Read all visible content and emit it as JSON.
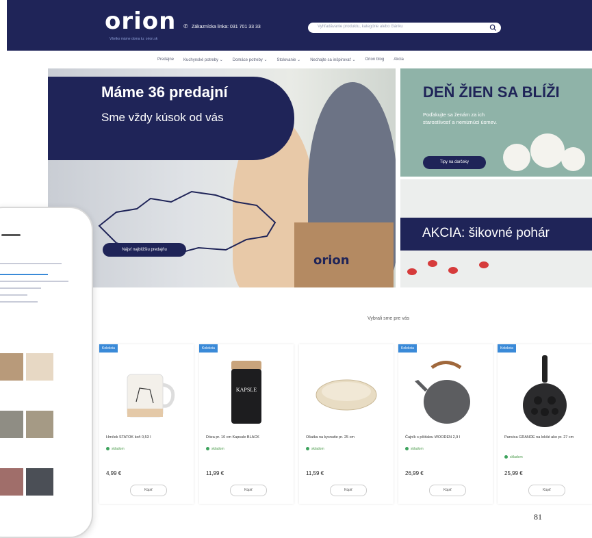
{
  "header": {
    "logo": "orion",
    "tagline": "Všetko máme doma tu: orion.sk",
    "phone": "Zákaznícka linka: 031 701 33 33",
    "search_placeholder": "Vyhľadávanie produktu, kategórie alebo článku",
    "bg_color": "#1f2458",
    "accent_color": "#3fa9f5"
  },
  "nav": {
    "items": [
      {
        "label": "Predajne"
      },
      {
        "label": "Kuchynské potreby ⌄"
      },
      {
        "label": "Domáce potreby ⌄"
      },
      {
        "label": "Stolovanie ⌄"
      },
      {
        "label": "Nechajte sa inšpirovať ⌄"
      },
      {
        "label": "Orion blog"
      },
      {
        "label": "Akcia"
      }
    ]
  },
  "hero": {
    "title": "Máme 36 predajní",
    "subtitle": "Sme vždy kúsok od vás",
    "button": "Nájsť najbližšiu predajňu",
    "bag_logo": "orion"
  },
  "promo1": {
    "title": "DEŇ ŽIEN SA BLÍŽI",
    "text": "Poďakujte sa ženám za ich starostlivosť a nemiznúci úsmev.",
    "button": "Tipy na darčeky"
  },
  "promo2": {
    "title": "AKCIA: šikovné pohár"
  },
  "section": {
    "title": "Vybrali sme pre vás"
  },
  "products": [
    {
      "badge": "Kolekcia",
      "name": "Hrnček STATOK koň 0,53 l",
      "stock": "skladom",
      "price": "4,99 €",
      "button": "Kúpiť"
    },
    {
      "badge": "Kolekcia",
      "name": "Dóza pr. 10 cm Kapsule BLACK",
      "stock": "skladom",
      "price": "11,99 €",
      "button": "Kúpiť"
    },
    {
      "badge": "",
      "name": "Ošatka na kysnutie pr. 25 cm",
      "stock": "skladom",
      "price": "11,59 €",
      "button": "Kúpiť"
    },
    {
      "badge": "Kolekcia",
      "name": "Čajník s píšťalou WOODEN 2,9 l",
      "stock": "skladom",
      "price": "26,99 €",
      "button": "Kúpiť"
    },
    {
      "badge": "Kolekcia",
      "name": "Panvica GRANDE na lokšé ako pr. 27 cm",
      "stock": "skladom",
      "price": "25,99 €",
      "button": "Kúpiť"
    }
  ],
  "page_number": "81"
}
